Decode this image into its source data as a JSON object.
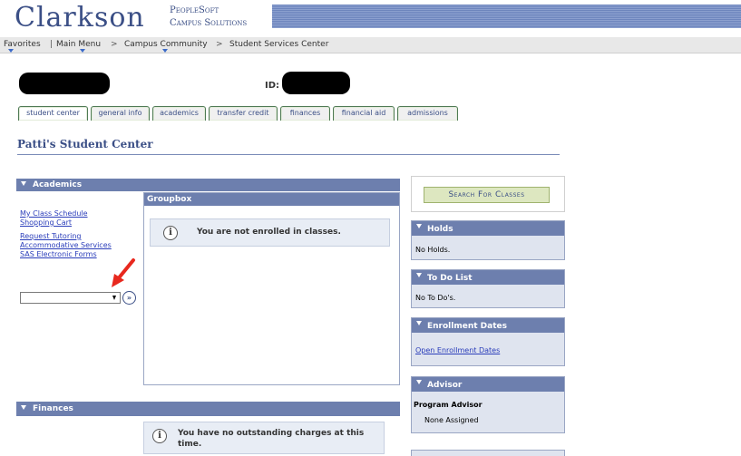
{
  "brand": {
    "name": "Clarkson",
    "line1": "PeopleSoft",
    "line2": "Campus Solutions"
  },
  "nav": {
    "favorites": "Favorites",
    "main_menu": "Main Menu",
    "campus_community": "Campus Community",
    "student_services": "Student Services Center",
    "separator": ">"
  },
  "student": {
    "id_label": "ID:"
  },
  "tabs": [
    {
      "label": "student center",
      "active": true
    },
    {
      "label": "general info"
    },
    {
      "label": "academics"
    },
    {
      "label": "transfer credit"
    },
    {
      "label": "finances"
    },
    {
      "label": "financial aid"
    },
    {
      "label": "admissions"
    }
  ],
  "page": {
    "title": "Patti's Student Center"
  },
  "academics": {
    "header": "Academics",
    "links": [
      "My Class Schedule",
      "Shopping Cart",
      "Request Tutoring",
      "Accommodative Services",
      "SAS Electronic Forms"
    ],
    "select_value": "",
    "go_icon": "double-chevron-right-icon",
    "groupbox_title": "Groupbox",
    "message": "You are not enrolled in classes."
  },
  "finances": {
    "header": "Finances",
    "message": "You have no outstanding charges at this time."
  },
  "search": {
    "label": "Search For Classes"
  },
  "holds": {
    "header": "Holds",
    "text": "No Holds."
  },
  "todo": {
    "header": "To Do List",
    "text": "No To Do's."
  },
  "enrollment": {
    "header": "Enrollment Dates",
    "link": "Open Enrollment Dates"
  },
  "advisor": {
    "header": "Advisor",
    "program_label": "Program Advisor",
    "value": "None Assigned"
  },
  "colors": {
    "section_header": "#6d7fae",
    "brand": "#3b4f86",
    "search_button": "#dde7c0",
    "link": "#2a3dba",
    "annotation_arrow": "#e8281e"
  }
}
